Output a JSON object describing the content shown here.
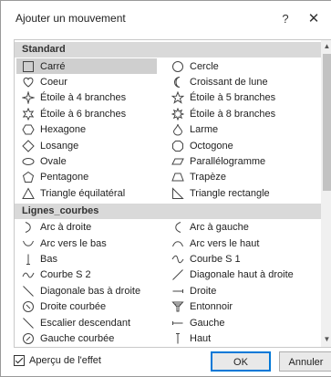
{
  "dialog": {
    "title": "Ajouter un mouvement",
    "help_label": "?",
    "close_label": "✕"
  },
  "sections": [
    {
      "label": "Standard",
      "items": [
        {
          "label": "Carré",
          "icon": "square-icon",
          "selected": true
        },
        {
          "label": "Cercle",
          "icon": "circle-icon"
        },
        {
          "label": "Coeur",
          "icon": "heart-icon"
        },
        {
          "label": "Croissant de lune",
          "icon": "crescent-icon"
        },
        {
          "label": "Étoile à 4 branches",
          "icon": "star4-icon"
        },
        {
          "label": "Étoile à 5 branches",
          "icon": "star5-icon"
        },
        {
          "label": "Étoile à 6 branches",
          "icon": "star6-icon"
        },
        {
          "label": "Étoile à 8 branches",
          "icon": "star8-icon"
        },
        {
          "label": "Hexagone",
          "icon": "hexagon-icon"
        },
        {
          "label": "Larme",
          "icon": "teardrop-icon"
        },
        {
          "label": "Losange",
          "icon": "diamond-icon"
        },
        {
          "label": "Octogone",
          "icon": "octagon-icon"
        },
        {
          "label": "Ovale",
          "icon": "oval-icon"
        },
        {
          "label": "Parallélogramme",
          "icon": "parallelogram-icon"
        },
        {
          "label": "Pentagone",
          "icon": "pentagon-icon"
        },
        {
          "label": "Trapèze",
          "icon": "trapezoid-icon"
        },
        {
          "label": "Triangle équilatéral",
          "icon": "triangle-icon"
        },
        {
          "label": "Triangle rectangle",
          "icon": "right-triangle-icon"
        }
      ]
    },
    {
      "label": "Lignes_courbes",
      "items": [
        {
          "label": "Arc à droite",
          "icon": "arc-right-icon"
        },
        {
          "label": "Arc à gauche",
          "icon": "arc-left-icon"
        },
        {
          "label": "Arc vers le bas",
          "icon": "arc-down-icon"
        },
        {
          "label": "Arc vers le haut",
          "icon": "arc-up-icon"
        },
        {
          "label": "Bas",
          "icon": "line-down-icon"
        },
        {
          "label": "Courbe S 1",
          "icon": "s-curve1-icon"
        },
        {
          "label": "Courbe S 2",
          "icon": "s-curve2-icon"
        },
        {
          "label": "Diagonale haut à droite",
          "icon": "diag-up-right-icon"
        },
        {
          "label": "Diagonale bas à droite",
          "icon": "diag-down-right-icon"
        },
        {
          "label": "Droite",
          "icon": "line-right-icon"
        },
        {
          "label": "Droite courbée",
          "icon": "curved-right-icon"
        },
        {
          "label": "Entonnoir",
          "icon": "funnel-icon"
        },
        {
          "label": "Escalier descendant",
          "icon": "stairs-down-icon"
        },
        {
          "label": "Gauche",
          "icon": "line-left-icon"
        },
        {
          "label": "Gauche courbée",
          "icon": "curved-left-icon"
        },
        {
          "label": "Haut",
          "icon": "line-up-icon"
        }
      ]
    }
  ],
  "footer": {
    "preview_label": "Aperçu de l'effet",
    "preview_checked": true,
    "ok_label": "OK",
    "cancel_label": "Annuler"
  }
}
